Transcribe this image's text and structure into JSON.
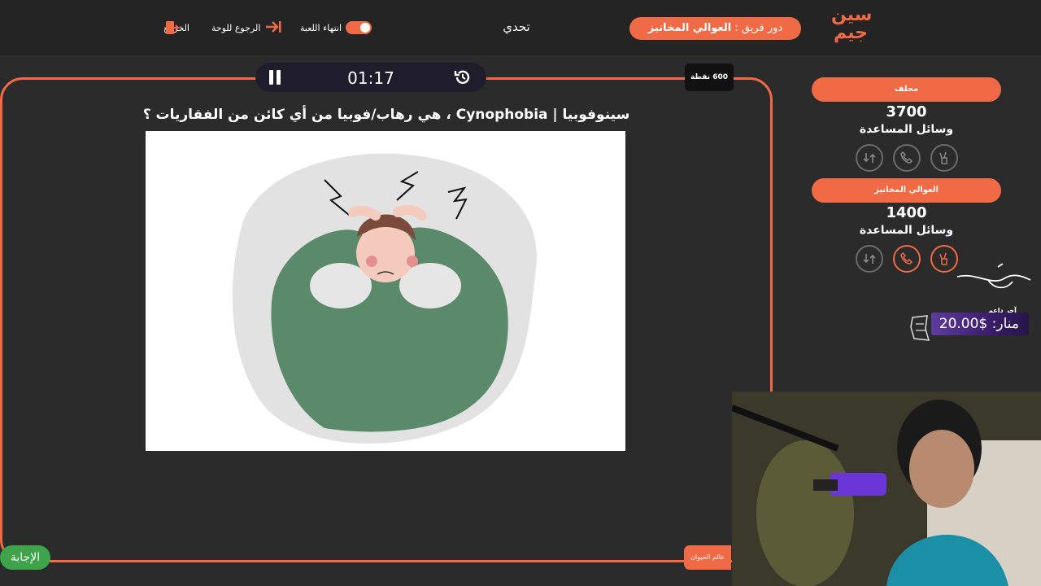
{
  "header": {
    "logo_text_top": "سين",
    "logo_text_bottom": "جيم",
    "turn_label": "دور فريق :",
    "turn_team": "العوالي المخانيز",
    "title": "تحدي",
    "end_game_label": "انتهاء اللعبة",
    "back_label": "الرجوع للوحة",
    "exit_label": "الخروج"
  },
  "game": {
    "timer": "01:17",
    "points": "600 نقطة",
    "question": "سينوفوبيا | Cynophobia ، هي رهاب/فوبيا من أي كائن من الفقاريات ؟",
    "answer_label": "الإجابة",
    "category": "عالم الحيوان"
  },
  "teams": [
    {
      "name": "محلف",
      "score": "3700",
      "helpers_label": "وسائل المساعدة"
    },
    {
      "name": "العوالي المخانيز",
      "score": "1400",
      "helpers_label": "وسائل المساعدة"
    }
  ],
  "supporter": {
    "label": "آخر داعم",
    "name": "منار",
    "amount": "20.00$"
  },
  "colors": {
    "accent": "#f06a45",
    "background": "#2b2b2b",
    "answer_green": "#3ea34a"
  }
}
